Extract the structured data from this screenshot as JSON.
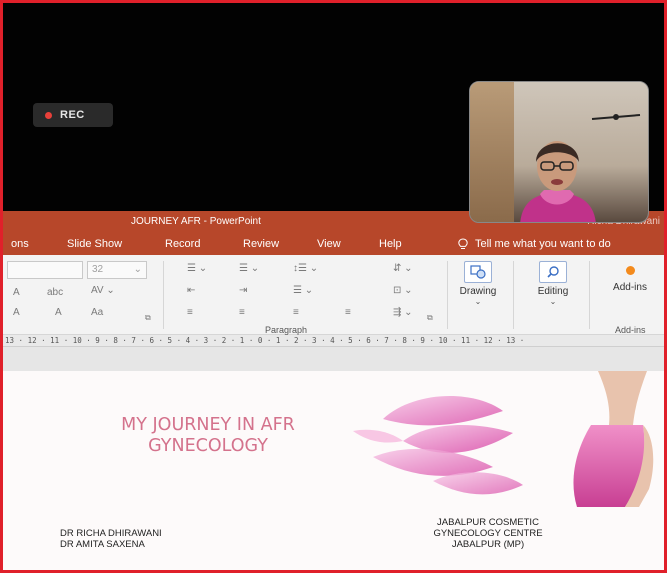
{
  "meeting": {
    "rec_label": "REC"
  },
  "powerpoint": {
    "window_title": "JOURNEY AFR  -  PowerPoint",
    "user_name": "Richa Dhirawani",
    "tabs": [
      "ons",
      "Slide Show",
      "Record",
      "Review",
      "View",
      "Help"
    ],
    "tell_me": "Tell me what you want to do",
    "font_size_value": "32",
    "group_labels": {
      "paragraph": "Paragraph",
      "addins": "Add-ins"
    },
    "buttons": {
      "drawing": "Drawing",
      "editing": "Editing",
      "addins": "Add-ins"
    },
    "ruler_text": "13 · 12 · 11 · 10 · 9 · 8 · 7 · 6 · 5 · 4 · 3 · 2 · 1 · 0 · 1 · 2 · 3 · 4 · 5 · 6 · 7 · 8 · 9 · 10 · 11 · 12 · 13 ·"
  },
  "slide": {
    "title_line1": "MY JOURNEY IN AFR",
    "title_line2": "GYNECOLOGY",
    "author1": "DR RICHA DHIRAWANI",
    "author2": "DR AMITA SAXENA",
    "centre_line1": "JABALPUR COSMETIC",
    "centre_line2": "GYNECOLOGY CENTRE",
    "centre_line3": "JABALPUR (MP)"
  },
  "colors": {
    "frame_border": "#e0202a",
    "ppt_accent": "#b7472a",
    "title_pink": "#d4728c"
  }
}
